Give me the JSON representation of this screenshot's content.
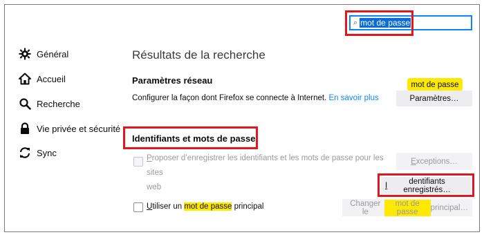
{
  "search": {
    "value": "mot de passe"
  },
  "sidebar": {
    "items": [
      {
        "label": "Général"
      },
      {
        "label": "Accueil"
      },
      {
        "label": "Recherche"
      },
      {
        "label": "Vie privée et sécurité"
      },
      {
        "label": "Sync"
      }
    ]
  },
  "main": {
    "title": "Résultats de la recherche",
    "network": {
      "title": "Paramètres réseau",
      "description": "Configurer la façon dont Firefox se connecte à Internet.",
      "learn_more": "En savoir plus",
      "button": "Paramètres…",
      "tooltip": "mot de passe"
    },
    "logins": {
      "title": "Identifiants et mots de passe",
      "offer_save_line1": "Proposer d’enregistrer les identifiants et les mots de passe pour les sites",
      "offer_save_line1_rest": "roposer d’enregistrer les identifiants et les mots de passe pour les sites",
      "offer_save_first": "P",
      "offer_save_line2": "web",
      "exceptions_button": "Exceptions…",
      "exceptions_first": "E",
      "exceptions_rest": "xceptions…",
      "saved_logins_button": "Identifiants enregistrés…",
      "saved_logins_first": "I",
      "saved_logins_rest": "dentifiants enregistrés…",
      "master_password_pre": "tiliser un ",
      "master_password_first": "U",
      "master_password_hl": "mot de passe",
      "master_password_post": " principal",
      "change_pre": "Changer le ",
      "change_hl": "mot de passe",
      "change_post": " principal…"
    }
  },
  "colors": {
    "highlight": "#ffe900",
    "annotation": "#e0171e",
    "link": "#0a84ff"
  }
}
